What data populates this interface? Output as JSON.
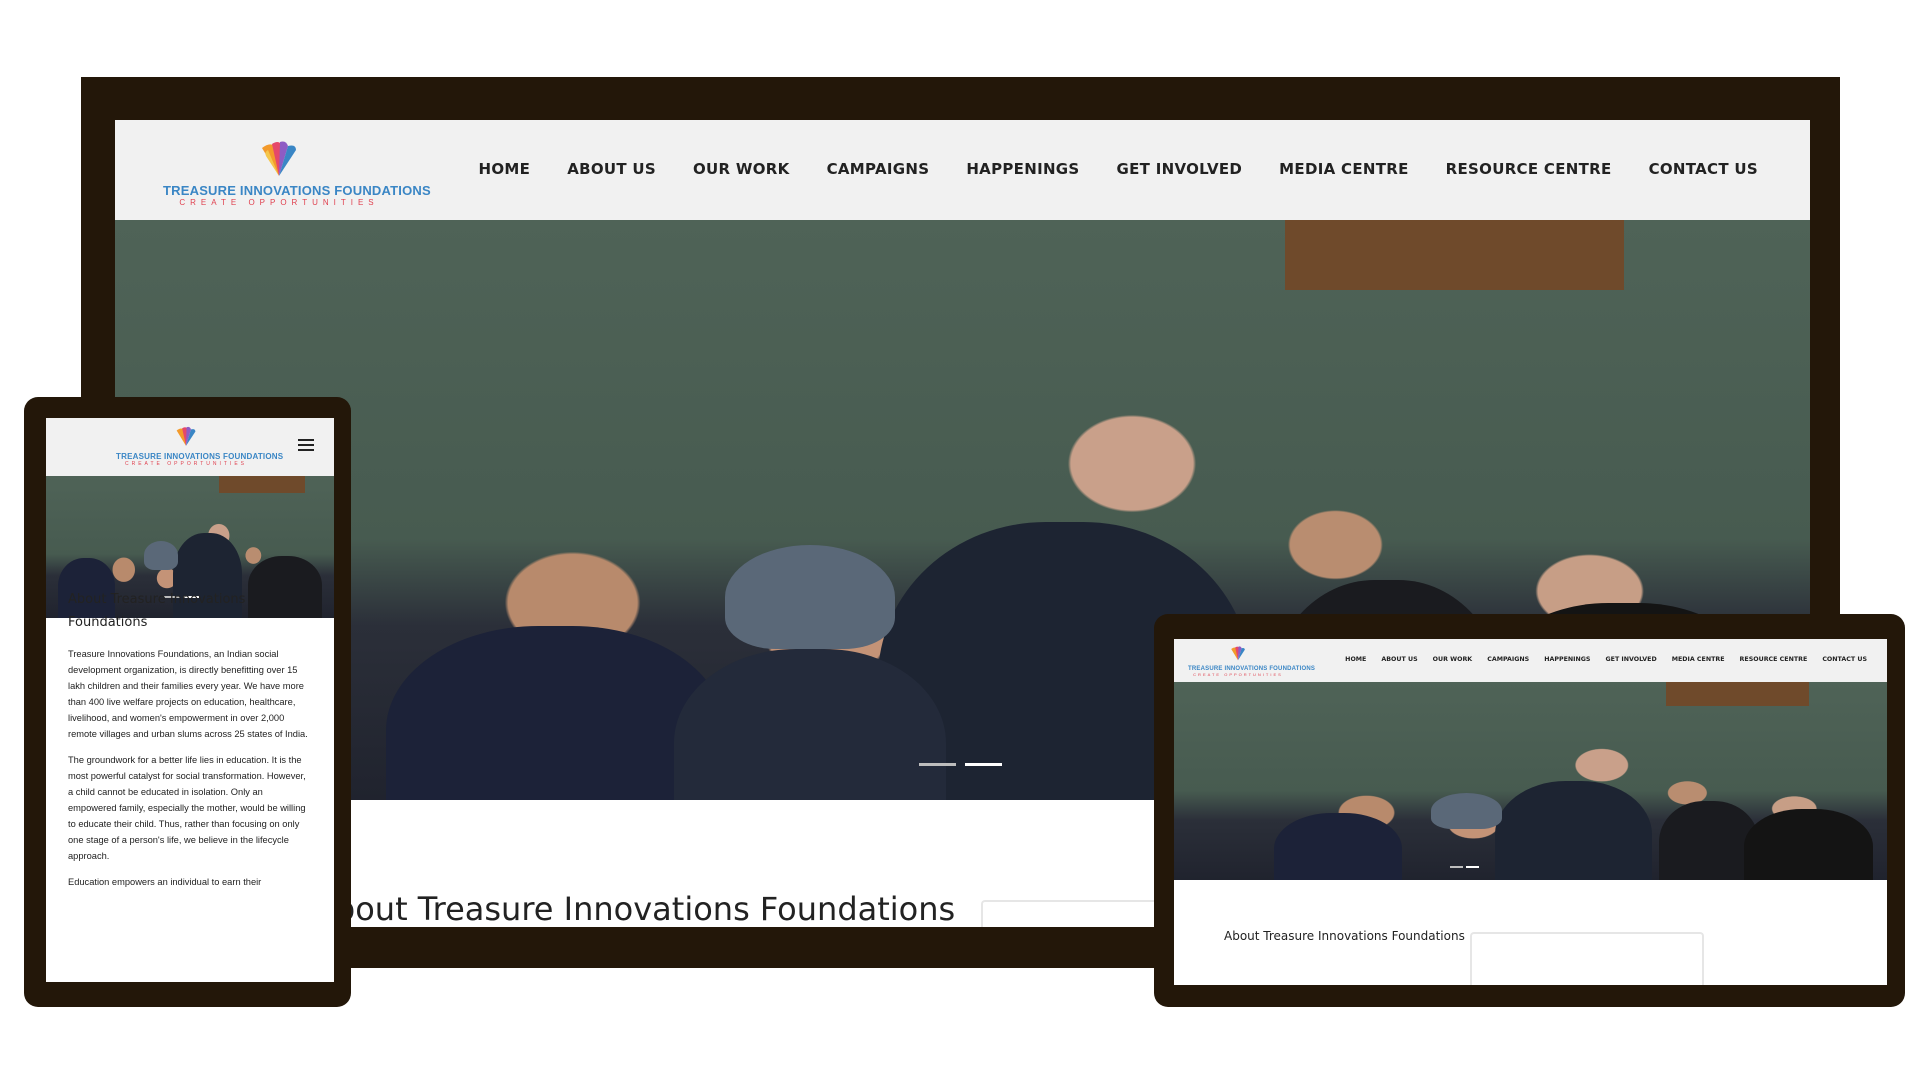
{
  "site": {
    "brand_name": "TREASURE INNOVATIONS FOUNDATIONS",
    "brand_tagline": "CREATE OPPORTUNITIES",
    "nav": [
      "HOME",
      "ABOUT US",
      "OUR WORK",
      "CAMPAIGNS",
      "HAPPENINGS",
      "GET INVOLVED",
      "MEDIA CENTRE",
      "RESOURCE CENTRE",
      "CONTACT US"
    ],
    "about_title": "About Treasure Innovations Foundations",
    "about_paragraphs": [
      "Treasure Innovations Foundations, an Indian social development organization, is directly benefitting over 15 lakh children and their families every year. We have more than 400 live welfare projects on education, healthcare, livelihood, and women's empowerment in over 2,000 remote villages and urban slums across 25 states of India.",
      "The groundwork for a better life lies in education. It is the most powerful catalyst for social transformation. However, a child cannot be educated in isolation. Only an empowered family, especially the mother, would be willing to educate their child. Thus, rather than focusing on only one stage of a person's life, we believe in the lifecycle approach.",
      "Education empowers an individual to earn their"
    ]
  },
  "hero": {
    "slides": 2,
    "active_slide": 2
  },
  "colors": {
    "frame": "#231709",
    "header": "#f1f1f1",
    "brand_blue": "#3a86c5",
    "brand_red": "#e0414f"
  },
  "icons": [
    "fan-logo-icon",
    "hamburger-menu-icon"
  ]
}
